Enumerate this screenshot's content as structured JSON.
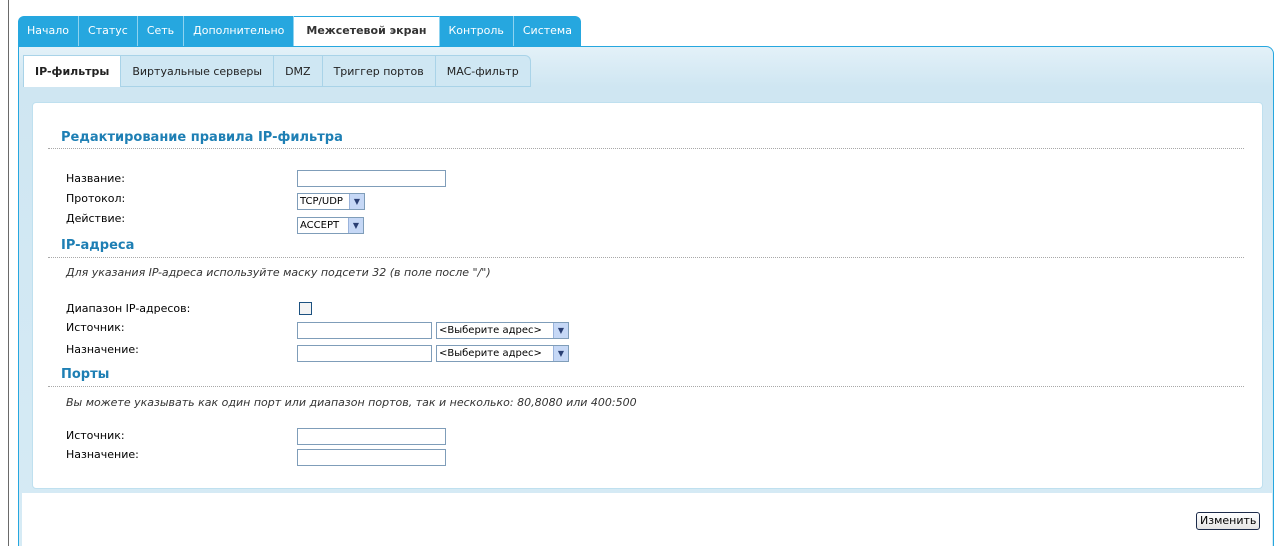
{
  "top_tabs": [
    "Начало",
    "Статус",
    "Сеть",
    "Дополнительно",
    "Межсетевой экран",
    "Контроль",
    "Система"
  ],
  "sub_tabs": [
    "IP-фильтры",
    "Виртуальные серверы",
    "DMZ",
    "Триггер портов",
    "MAC-фильтр"
  ],
  "form": {
    "title": "Редактирование правила IP-фильтра",
    "name_label": "Название:",
    "name_value": "",
    "protocol_label": "Протокол:",
    "protocol_value": "TCP/UDP",
    "action_label": "Действие:",
    "action_value": "ACCEPT"
  },
  "ip_section": {
    "title": "IP-адреса",
    "note": "Для указания IP-адреса используйте маску подсети 32 (в поле после \"/\")",
    "range_label": "Диапазон IP-адресов:",
    "range_checked": false,
    "source_label": "Источник:",
    "source_value": "",
    "source_select": "<Выберите адрес>",
    "dest_label": "Назначение:",
    "dest_value": "",
    "dest_select": "<Выберите адрес>"
  },
  "ports_section": {
    "title": "Порты",
    "note": "Вы можете указывать как один порт или диапазон портов, так и несколько: 80,8080 или 400:500",
    "source_label": "Источник:",
    "source_value": "",
    "dest_label": "Назначение:",
    "dest_value": ""
  },
  "buttons": {
    "save": "Изменить"
  },
  "icons": {
    "dropdown": "chevron-down-icon"
  }
}
